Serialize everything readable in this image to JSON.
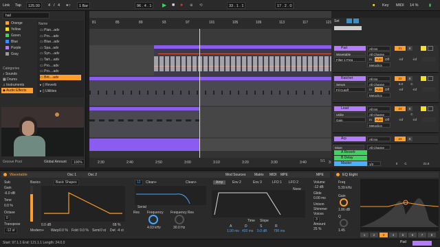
{
  "toolbar": {
    "link": "Link",
    "tap": "Tap",
    "tempo": "125.00",
    "sig_num": "4",
    "sig_den": "4",
    "quant": "1 Bar",
    "pos": "96 . 4 . 1",
    "loop_start": "33 . 1 . 1",
    "loop_len": "17 . 2 . 0",
    "key": "Key",
    "midi": "MIDI",
    "cpu": "14 %"
  },
  "browser": {
    "search": "hail",
    "colors": [
      "Orange",
      "Yellow",
      "Green",
      "Blue",
      "Purple",
      "Gray"
    ],
    "categories_label": "Categories",
    "categories": [
      "Sounds",
      "Drums",
      "Instruments",
      "Audio Effects"
    ],
    "name_header": "Name",
    "files": [
      "Pian...adv",
      "Pro....adv",
      "Blue...adv",
      "Spa...adv",
      "Syn....adv",
      "Tart....adv",
      "Pro....adv",
      "Pro....adv",
      "Brit....adv"
    ],
    "folders": [
      "Reverb",
      "Utilities"
    ],
    "groove_pool": "Groove Pool",
    "global_amount_label": "Global Amount",
    "global_amount": "100%"
  },
  "arrangement": {
    "bars": [
      "81",
      "85",
      "89",
      "93",
      "97",
      "101",
      "105",
      "109",
      "113",
      "117",
      "121"
    ],
    "times": [
      "2:30",
      "2:40",
      "2:50",
      "3:00",
      "3:10",
      "3:20",
      "3:30",
      "3:40",
      "3:50"
    ],
    "page": "1/1",
    "fraction": "5/1"
  },
  "mixer": {
    "tracks": [
      {
        "name": "Pad",
        "color": "#b57cff",
        "in": "All Ins",
        "inch": "All Channe",
        "dev": "Wavetable",
        "param": "Filter 1 Freq",
        "mon1": "In",
        "mon2": "Auto",
        "mon3": "Off",
        "num": "21",
        "s": "S",
        "vol": "-inf",
        "vol2": "-inf",
        "metro": "Metoclics"
      },
      {
        "name": "Ratchet",
        "color": "#b57cff",
        "in": "All Ins",
        "inch": "All Channe",
        "dev": "Serum",
        "param": "Fil Cutoff",
        "mon1": "In",
        "mon2": "Auto",
        "mon3": "Off",
        "num": "22",
        "s": "S",
        "vol": "-inf",
        "vol2": "-inf",
        "metro": "Metoclics",
        "pan": "5.0",
        "c": "C"
      },
      {
        "name": "Lead",
        "color": "#b57cff",
        "in": "All Ins",
        "inch": "All Channe",
        "dev": "Utility",
        "param": "Gain",
        "mon1": "In",
        "mon2": "Auto",
        "mon3": "Off",
        "num": "23",
        "s": "S",
        "vol": "-inf",
        "vol2": "-inf",
        "metro": "Metoclics",
        "c": "C"
      }
    ],
    "arp": {
      "name": "Arp",
      "in": "All Ins",
      "inch": "All Channe",
      "dev": "Mixer",
      "num": "24",
      "s": "S"
    },
    "returns": [
      {
        "name": "A Reverb",
        "letter": "A"
      },
      {
        "name": "B Delay",
        "letter": "B"
      }
    ],
    "master": {
      "name": "Master",
      "sel": "1/2",
      "val": "0",
      "c": "C",
      "db": "21.6"
    },
    "set_label": "Set"
  },
  "wavetable": {
    "title": "Wavetable",
    "osc1": "Osc 1",
    "osc2": "Osc 2",
    "tabs": [
      "Basics",
      "Basic Shapes"
    ],
    "sub": "Sub",
    "gain_label": "Gain",
    "gain": "-6.0 dB",
    "tone_label": "Tone",
    "tone": "0.0 %",
    "octave_label": "Octave",
    "octave": "0",
    "transpose_label": "Transpose",
    "transpose": "-12 st",
    "osc_gain": "0.0 dB",
    "fx": "Modern+",
    "warp": "Warp",
    "warp_val": "0.0 %",
    "fold": "Fold",
    "fold_val": "0.0 %",
    "semi": "Semi",
    "semi_val": "0 st",
    "det": "Det",
    "det_val": "-4 ct",
    "pct": "68 %",
    "filter1": "Clean+",
    "filter2": "Clean+",
    "f1num": "12",
    "serial": "Serial",
    "res1": "Res",
    "freq1": "Frequency",
    "freq1_val": "4.03 kHz",
    "freq2": "Frequency Res",
    "freq2_val": "30.0 Hz",
    "amp_tab": "Amp",
    "env2": "Env 2",
    "env3": "Env 3",
    "lfo1": "LFO 1",
    "lfo2": "LFO 2",
    "time": "Time",
    "slope": "Slope",
    "adsr": [
      "A",
      "D",
      "S",
      "R"
    ],
    "adsr_vals": [
      "1.00 ms",
      "420 ms",
      "0.0 dB",
      "790 ms"
    ],
    "none": "None",
    "mod_sources": "Mod Sources",
    "matrix": "Matrix",
    "midi": "MIDI",
    "mpe": "MPE",
    "volume_label": "Volume",
    "volume": "-12 dB",
    "glide_label": "Glide",
    "glide": "0.00 ms",
    "unison_label": "Unison",
    "unison_type": "Shimmer",
    "voices_label": "Voices",
    "voices": "3",
    "amount_label": "Amount",
    "amount": "25 %"
  },
  "eq": {
    "title": "EQ Eight",
    "freq_label": "Freq",
    "freq": "5.39 kHz",
    "gain_label": "Gain",
    "gain": "1.86 dB",
    "q_label": "Q",
    "q": "1.45",
    "bands": [
      "1",
      "2",
      "3",
      "4",
      "5",
      "6",
      "7",
      "8"
    ]
  },
  "status": {
    "text": "Start: 97.1.1  End: 121.1.1  Length: 24.0.0",
    "pad": "Pad"
  },
  "colors": {
    "purple": "#8a5cf0",
    "orange": "#ff9e2a",
    "green": "#3fd25e",
    "yellow": "#f5e12c"
  }
}
